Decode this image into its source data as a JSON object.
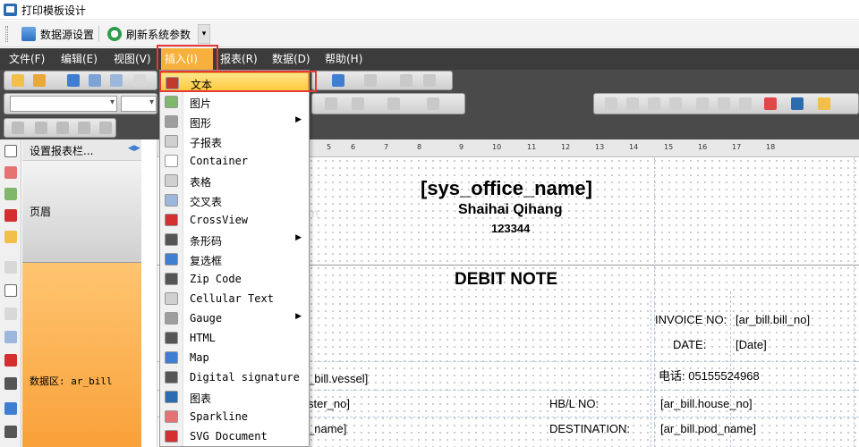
{
  "window": {
    "title": "打印模板设计"
  },
  "quickbar": {
    "datasource_label": "数据源设置",
    "refresh_label": "刷新系统参数"
  },
  "menubar": {
    "items": [
      "文件(F)",
      "编辑(E)",
      "视图(V)",
      "插入(I)",
      "报表(R)",
      "数据(D)",
      "帮助(H)"
    ],
    "active_index": 3
  },
  "insert_menu": {
    "items": [
      {
        "label": "文本",
        "icon": "text-icon",
        "submenu": false
      },
      {
        "label": "图片",
        "icon": "picture-icon",
        "submenu": false
      },
      {
        "label": "图形",
        "icon": "shape-icon",
        "submenu": true
      },
      {
        "label": "子报表",
        "icon": "subreport-icon",
        "submenu": false
      },
      {
        "label": "Container",
        "icon": "container-icon",
        "submenu": false
      },
      {
        "label": "表格",
        "icon": "table-icon",
        "submenu": false
      },
      {
        "label": "交叉表",
        "icon": "crosstab-icon",
        "submenu": false
      },
      {
        "label": "CrossView",
        "icon": "crossview-icon",
        "submenu": false
      },
      {
        "label": "条形码",
        "icon": "barcode-icon",
        "submenu": true
      },
      {
        "label": "复选框",
        "icon": "checkbox-icon",
        "submenu": false
      },
      {
        "label": "Zip Code",
        "icon": "zipcode-icon",
        "submenu": false
      },
      {
        "label": "Cellular Text",
        "icon": "cellular-text-icon",
        "submenu": false
      },
      {
        "label": "Gauge",
        "icon": "gauge-icon",
        "submenu": true
      },
      {
        "label": "HTML",
        "icon": "html-icon",
        "submenu": false
      },
      {
        "label": "Map",
        "icon": "map-icon",
        "submenu": false
      },
      {
        "label": "Digital signature",
        "icon": "signature-icon",
        "submenu": false
      },
      {
        "label": "图表",
        "icon": "chart-icon",
        "submenu": false
      },
      {
        "label": "Sparkline",
        "icon": "sparkline-icon",
        "submenu": false
      },
      {
        "label": "SVG Document",
        "icon": "svg-icon",
        "submenu": false
      }
    ],
    "highlighted_index": 0
  },
  "bands": {
    "panel_header": "设置报表栏...",
    "page_header_label": "页眉",
    "data_label": "数据区: ar_bill"
  },
  "ruler": {
    "ticks": [
      "5",
      "6",
      "7",
      "8",
      "9",
      "10",
      "11",
      "12",
      "13",
      "14",
      "15",
      "16",
      "17",
      "18"
    ]
  },
  "report": {
    "office_name": "[sys_office_name]",
    "company": "Shaihai Qihang",
    "code": "123344",
    "title": "DEBIT NOTE",
    "invoice_label": "INVOICE NO:",
    "invoice_value": "[ar_bill.bill_no]",
    "date_label": "DATE:",
    "date_value": "[Date]",
    "vessel_field": "_bill.vessel]",
    "phone": "电话: 05155524968",
    "master_field": "ster_no]",
    "hbl_label": "HB/L NO:",
    "hbl_value": "[ar_bill.house_no]",
    "name_field": "_name]",
    "destination_label": "DESTINATION:",
    "destination_value": "[ar_bill.pod_name]",
    "faded_text": "m"
  },
  "colors": {
    "menubar_bg": "#3c3c3c",
    "menu_active": "#f7b03c",
    "highlight_box": "#e53935",
    "data_band": "#f9a13a"
  }
}
